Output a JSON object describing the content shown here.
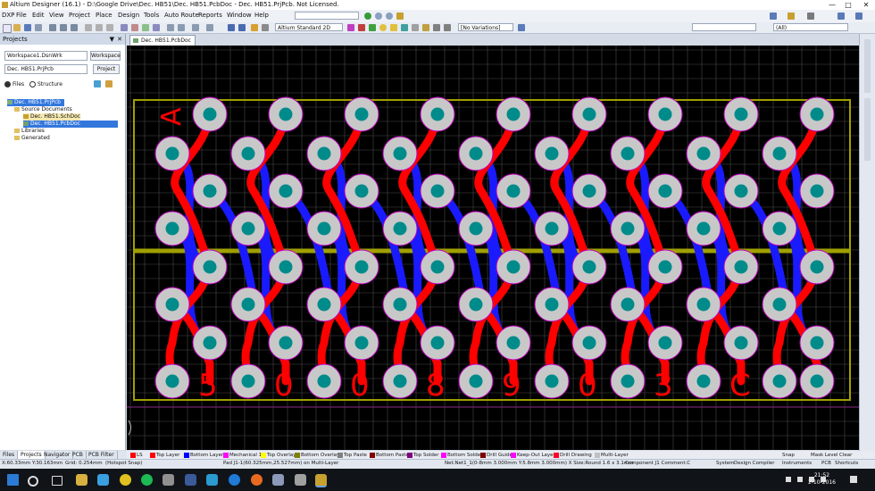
{
  "window": {
    "title": "Altium Designer (16.1) - D:\\Google Drive\\Dec. HB51\\Dec. HB51.PcbDoc - Dec. HB51.PrjPcb. Not Licensed.",
    "controls": [
      "—",
      "□",
      "✕"
    ]
  },
  "menu": {
    "items": [
      "DXP",
      "File",
      "Edit",
      "View",
      "Project",
      "Place",
      "Design",
      "Tools",
      "Auto Route",
      "Reports",
      "Window",
      "Help"
    ],
    "path_field": ""
  },
  "toolbar": {
    "standard_field": "Altium Standard 2D",
    "variations_field": "[No Variations]",
    "filter_field": "(All)"
  },
  "panel": {
    "title": "Projects",
    "workspace_value": "Workspace1.DsnWrk",
    "workspace_button": "Workspace",
    "project_value": "Dec. HB51.PrjPcb",
    "project_button": "Project",
    "view_files": "Files",
    "view_structure": "Structure",
    "tree": [
      {
        "label": "Dec. HB51.PrjPcb",
        "selected": true
      },
      {
        "label": "Source Documents",
        "selected": false
      },
      {
        "label": "Dec. HB51.SchDoc",
        "selected": false
      },
      {
        "label": "Dec. HB51.PcbDoc",
        "selected": true
      },
      {
        "label": "Libraries",
        "selected": false
      },
      {
        "label": "Generated",
        "selected": false
      }
    ],
    "tabs": [
      "Files",
      "Projects",
      "Navigator",
      "PCB",
      "PCB Filter"
    ]
  },
  "document": {
    "tab_label": "Dec. HB51.PcbDoc",
    "top_labels": [
      "A"
    ],
    "bottom_labels": [
      "5",
      "0",
      "0",
      "8",
      "9",
      "0",
      "3",
      "C"
    ]
  },
  "layers": [
    {
      "label": "LS",
      "color": "#ff0000"
    },
    {
      "label": "Top Layer",
      "color": "#ff0000"
    },
    {
      "label": "Bottom Layer",
      "color": "#0000ff"
    },
    {
      "label": "Mechanical 1",
      "color": "#ff00ff"
    },
    {
      "label": "Top Overlay",
      "color": "#ffff00"
    },
    {
      "label": "Bottom Overlay",
      "color": "#808000"
    },
    {
      "label": "Top Paste",
      "color": "#808080"
    },
    {
      "label": "Bottom Paste",
      "color": "#800000"
    },
    {
      "label": "Top Solder",
      "color": "#800080"
    },
    {
      "label": "Bottom Solder",
      "color": "#ff00ff"
    },
    {
      "label": "Drill Guide",
      "color": "#800000"
    },
    {
      "label": "Keep-Out Layer",
      "color": "#ff00ff"
    },
    {
      "label": "Drill Drawing",
      "color": "#ff002a"
    },
    {
      "label": "Multi-Layer",
      "color": "#c0c0c0"
    }
  ],
  "layer_controls": [
    "Snap",
    "Mask Level",
    "Clear"
  ],
  "status": {
    "coords": "X:60.33mm Y:30.163mm",
    "grid": "Grid: 0.254mm",
    "snap": "(Hotspot Snap)",
    "pad": "Pad J1-1(60.325mm,25.527mm) on Multi-Layer",
    "net": "Net:Net1_1(0-8mm 3.000mm Y:5.8mm 3.000mm) X Size:Round 1.6 x 3.1mm",
    "component": "Component J1 Comment:C",
    "system": "System",
    "design_compiler": "Design Compiler",
    "instruments": "Instruments",
    "pcb": "PCB",
    "shortcuts": "Shortcuts"
  },
  "taskbar": {
    "time": "21:52",
    "date": "2-10-2016"
  },
  "colors": {
    "board_bg": "#000000",
    "grid": "#4a4a4a",
    "top_trace": "#ff0000",
    "bottom_trace": "#1a1aff",
    "pad": "#c8c8c8",
    "hole": "#008b8b",
    "overlay": "#a0a000"
  }
}
